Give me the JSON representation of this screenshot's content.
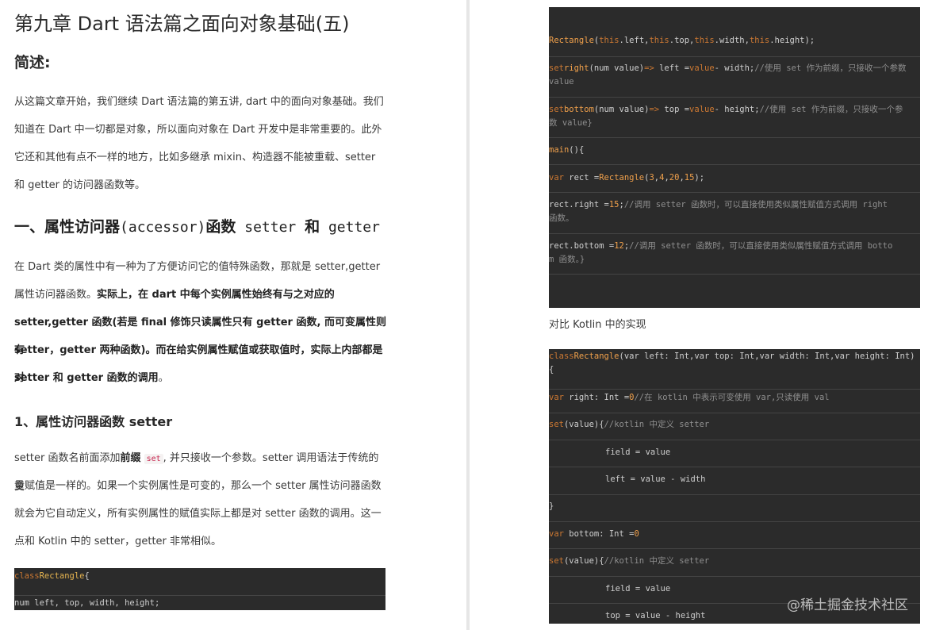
{
  "left": {
    "title": "第九章 Dart 语法篇之面向对象基础(五)",
    "summary_heading": "简述:",
    "intro_lines": [
      "从这篇文章开始，我们继续 Dart 语法篇的第五讲, dart 中的面向对象基础。我们",
      "知道在 Dart 中一切都是对象，所以面向对象在 Dart 开发中是非常重要的。此外",
      "它还和其他有点不一样的地方，比如多继承 mixin、构造器不能被重载、setter",
      "和 getter 的访问器函数等。"
    ],
    "section1_prefix": "一、属性访问器",
    "section1_mono": "(accessor)",
    "section1_mid": "函数",
    "section1_mono2": " setter ",
    "section1_and": "和",
    "section1_mono3": " getter",
    "section1_p1_normal1": "在 Dart 类的属性中有一种为了方便访问它的值特殊函数，那就是 setter,getter",
    "section1_p1_normal2": "属性访问器函数。",
    "section1_p1_bold2": "实际上，在 dart 中每个实例属性始终有与之对应的",
    "section1_p1_bold3": "setter,getter 函数(若是 final 修饰只读属性只有 getter 函数, 而可变属性则有",
    "section1_p1_bold4": "setter，getter 两种函数)。而在给实例属性赋值或获取值时，实际上内部都是对",
    "section1_p1_bold5": "setter 和 getter 函数的调用",
    "section1_p1_end": "。",
    "sub_heading": "1、属性访问器函数 setter",
    "p2_line1_a": "setter 函数名前面添加",
    "p2_line1_bold": "前缀",
    "p2_line1_code": "set",
    "p2_line1_b": ", 并只接收一个参数。setter 调用语法于传统的变",
    "p2_line2": "量赋值是一样的。如果一个实例属性是可变的，那么一个 setter 属性访问器函数",
    "p2_line3": "就会为它自动定义，所有实例属性的赋值实际上都是对 setter 函数的调用。这一",
    "p2_line4": "点和 Kotlin 中的 setter，getter 非常相似。",
    "code": {
      "l1_kw": "class",
      "l1_cls": "Rectangle",
      "l1_rest": "{",
      "l2": "  num left, top, width, height;"
    }
  },
  "right": {
    "code1": {
      "l1_cls": "Rectangle",
      "l1_a": "(",
      "l1_this1": "this",
      "l1_b": ".left,",
      "l1_this2": "this",
      "l1_c": ".top,",
      "l1_this3": "this",
      "l1_d": ".width,",
      "l1_this4": "this",
      "l1_e": ".height);",
      "l2_kw": "set",
      "l2_fn": "right",
      "l2_a": "(num value)",
      "l2_arrow": "=>",
      "l2_b": " left =",
      "l2_c": "value",
      "l2_d": "- width;",
      "l2_cm": "//使用 set 作为前缀，只接收一个参数",
      "l2_cont": "value",
      "l3_kw": "set",
      "l3_fn": "bottom",
      "l3_a": "(num value)",
      "l3_arrow": "=>",
      "l3_b": " top =",
      "l3_c": "value",
      "l3_d": "- height;",
      "l3_cm": "//使用 set 作为前缀，只接收一个参",
      "l3_cont": "数 value}",
      "l4_fn": "main",
      "l4_rest": "(){",
      "l5_kw": "var",
      "l5_a": " rect =",
      "l5_cls": "Rectangle",
      "l5_b": "(",
      "l5_n1": "3",
      "l5_n2": "4",
      "l5_n3": "20",
      "l5_n4": "15",
      "l5_end": ");",
      "l6_a": "  rect.right =",
      "l6_n": "15",
      "l6_b": ";",
      "l6_cm": "//调用 setter 函数时，可以直接使用类似属性赋值方式调用 right",
      "l6_cont": "函数。",
      "l7_a": "  rect.bottom =",
      "l7_n": "12",
      "l7_b": ";",
      "l7_cm": "//调用 setter 函数时，可以直接使用类似属性赋值方式调用 botto",
      "l7_cont": "m 函数。}"
    },
    "caption": "对比 Kotlin 中的实现",
    "code2": {
      "l1_kw": "class",
      "l1_cls": "Rectangle",
      "l1_rest": "(var left: Int,var top: Int,var width: Int,var height: Int)",
      "l1_cont": "{",
      "l2_kw": "var",
      "l2_a": " right: Int =",
      "l2_n": "0",
      "l2_cm": "//在 kotlin 中表示可变使用 var,只读使用 val",
      "l3_kw": "set",
      "l3_a": "(value){",
      "l3_cm": "//kotlin 中定义 setter",
      "l4": "field = value",
      "l5": "left = value - width",
      "l6": "}",
      "l7_kw": "var",
      "l7_a": " bottom: Int =",
      "l7_n": "0",
      "l8_kw": "set",
      "l8_a": "(value){",
      "l8_cm": "//kotlin 中定义 setter",
      "l9": "field = value",
      "l10": "top = value - height"
    },
    "watermark": "@稀土掘金技术社区"
  }
}
